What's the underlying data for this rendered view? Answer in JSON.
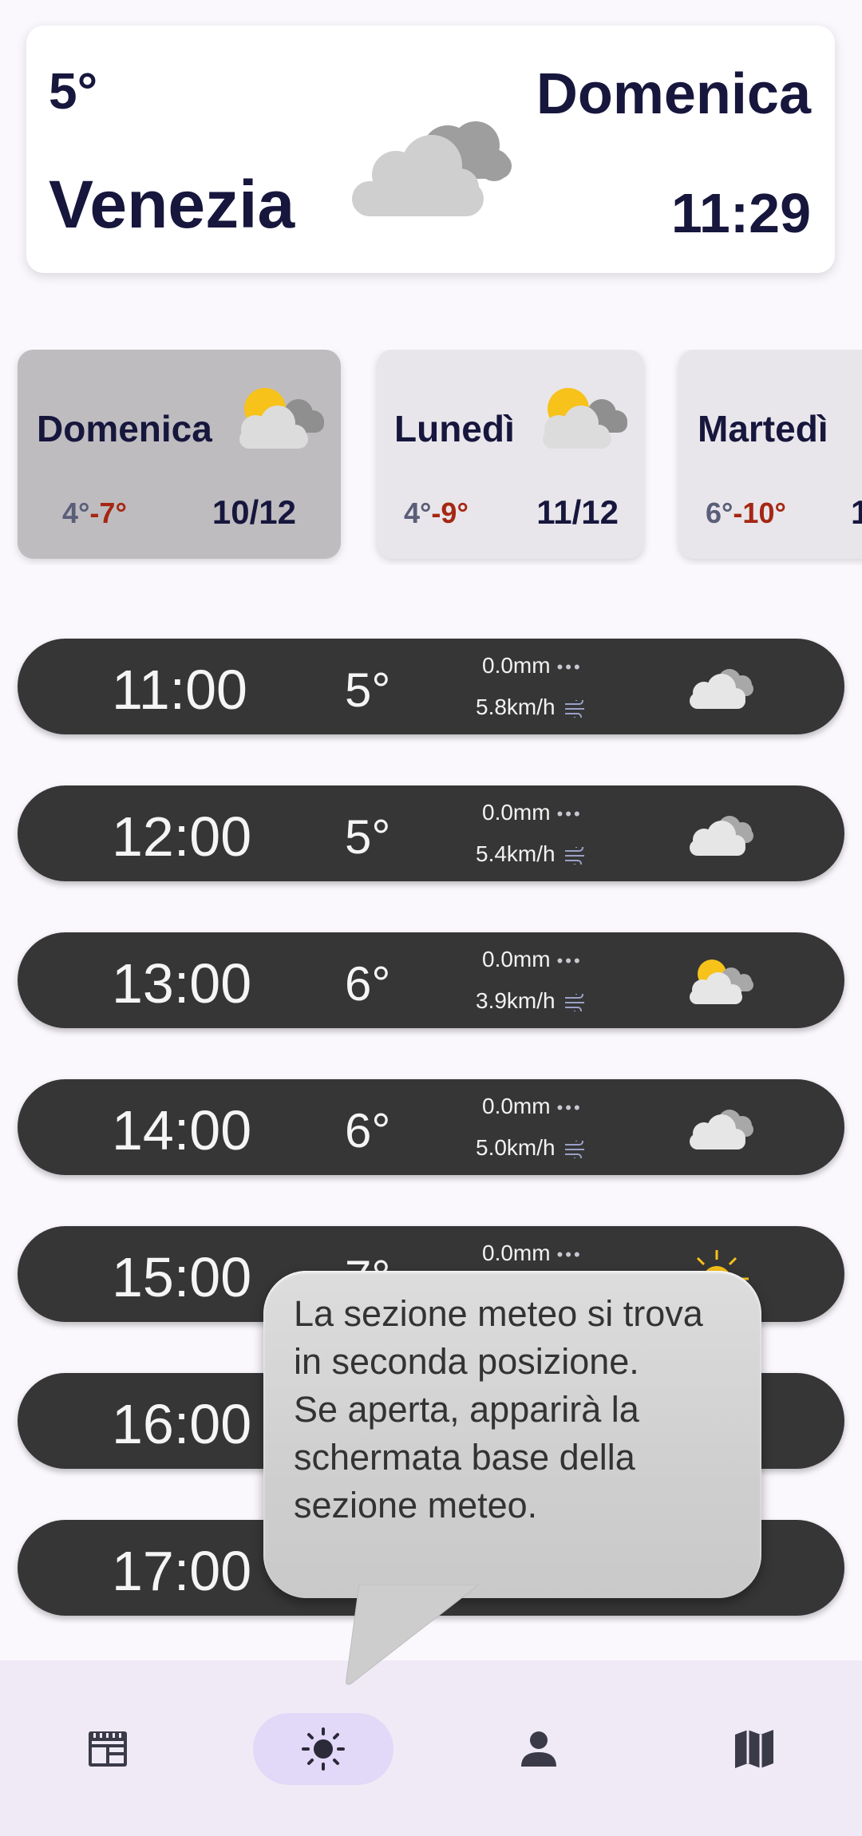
{
  "header": {
    "temperature": "5°",
    "city": "Venezia",
    "day": "Domenica",
    "time": "11:29",
    "icon": "cloudy-icon"
  },
  "days": [
    {
      "name": "Domenica",
      "min": "4°",
      "max": "7°",
      "date": "10/12",
      "icon": "partly-cloudy-icon",
      "selected": true
    },
    {
      "name": "Lunedì",
      "min": "4°",
      "max": "9°",
      "date": "11/12",
      "icon": "partly-cloudy-icon",
      "selected": false
    },
    {
      "name": "Martedì",
      "min": "6°",
      "max": "10°",
      "date": "1",
      "icon": "partly-cloudy-icon",
      "selected": false
    }
  ],
  "range_separator": "-",
  "hours": [
    {
      "time": "11:00",
      "temp": "5°",
      "rain": "0.0mm",
      "wind": "5.8km/h",
      "icon": "cloudy-icon"
    },
    {
      "time": "12:00",
      "temp": "5°",
      "rain": "0.0mm",
      "wind": "5.4km/h",
      "icon": "cloudy-icon"
    },
    {
      "time": "13:00",
      "temp": "6°",
      "rain": "0.0mm",
      "wind": "3.9km/h",
      "icon": "partly-cloudy-icon"
    },
    {
      "time": "14:00",
      "temp": "6°",
      "rain": "0.0mm",
      "wind": "5.0km/h",
      "icon": "cloudy-icon"
    },
    {
      "time": "15:00",
      "temp": "7°",
      "rain": "0.0mm",
      "wind": "",
      "icon": "sun-icon"
    },
    {
      "time": "16:00",
      "temp": "",
      "rain": "",
      "wind": "",
      "icon": ""
    },
    {
      "time": "17:00",
      "temp": "",
      "rain": "",
      "wind": "",
      "icon": ""
    }
  ],
  "tooltip": {
    "lines": [
      "La sezione meteo si trova",
      "in seconda posizione.",
      "Se aperta, apparirà la",
      "schermata base della",
      "sezione meteo."
    ]
  },
  "nav": [
    {
      "icon": "news-icon",
      "active": false
    },
    {
      "icon": "weather-sun-icon",
      "active": true
    },
    {
      "icon": "person-icon",
      "active": false
    },
    {
      "icon": "map-icon",
      "active": false
    }
  ],
  "colors": {
    "dark_text": "#17163d",
    "max_temp": "#a52713",
    "min_temp": "#5a5e78",
    "row_bg": "#363636",
    "nav_active": "#e2d8f8",
    "sun": "#f7c21a"
  }
}
